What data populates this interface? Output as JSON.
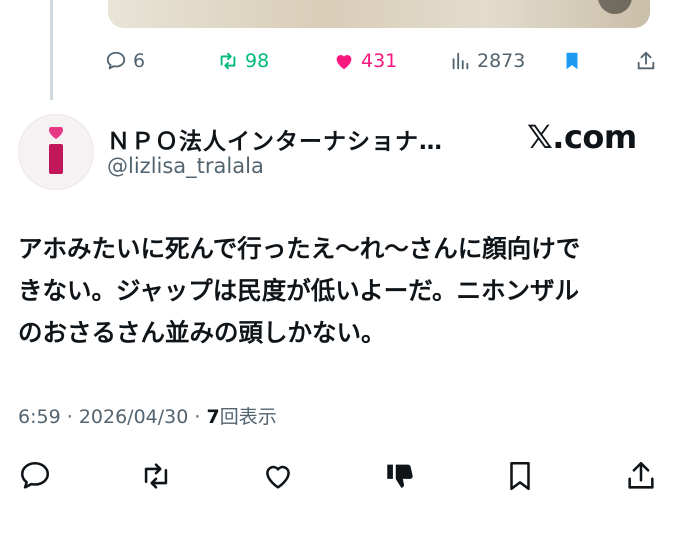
{
  "previous_tweet": {
    "stats": {
      "replies": "6",
      "retweets": "98",
      "likes": "431",
      "views": "2873"
    }
  },
  "tweet": {
    "author_name": "ＮＰＯ法人インターナショナ…",
    "author_handle": "@lizlisa_tralala",
    "watermark": "𝕏.com",
    "text_lines": [
      "アホみたいに死んで行ったえ〜れ〜さんに顔向けで",
      "きない。ジャップは民度が低いよーだ。ニホンザル",
      "のおさるさん並みの頭しかない。"
    ],
    "time": "6:59",
    "date": "2026/04/30",
    "separator": "·",
    "views_count": "7",
    "views_label": "回表示"
  },
  "colors": {
    "text_primary": "#0f1419",
    "text_secondary": "#536471",
    "retweet_green": "#00ba7c",
    "like_pink": "#f91880",
    "bookmark_blue": "#1d9bf0",
    "avatar_accent": "#c2185b"
  },
  "icons": {
    "reply": "reply-icon",
    "retweet": "retweet-icon",
    "like": "heart-icon",
    "views": "bar-chart-icon",
    "bookmark": "bookmark-icon",
    "share": "share-icon",
    "dislike": "thumbs-down-icon"
  }
}
